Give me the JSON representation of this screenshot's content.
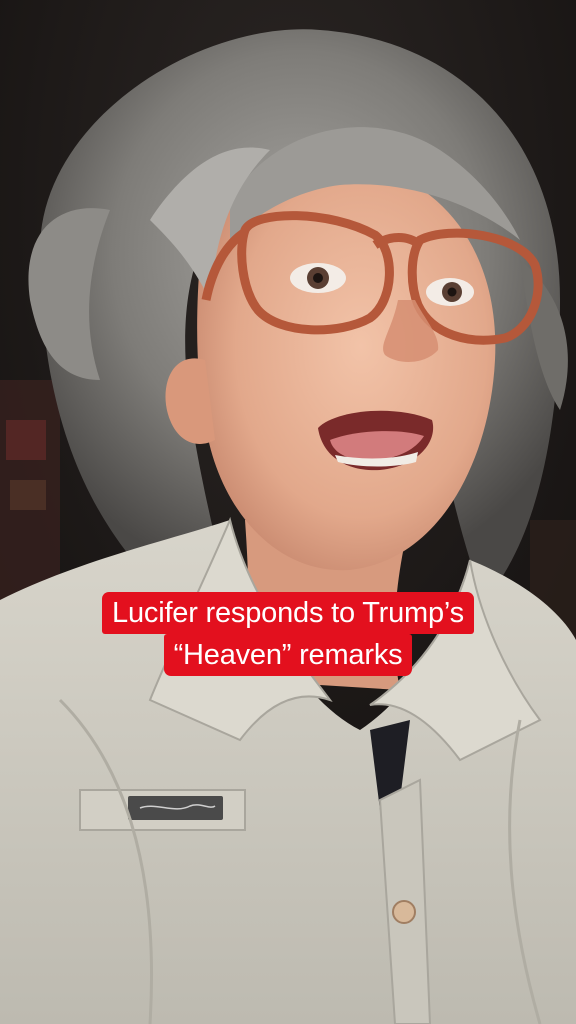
{
  "caption": {
    "line1": "Lucifer responds to Trump’s",
    "line2": "“Heaven” remarks",
    "background_color": "#e3101e",
    "text_color": "#ffffff"
  },
  "scene": {
    "subject": "person-with-gray-hair-and-glasses",
    "shirt_color": "#cfccc2",
    "hair_color": "#8e8c88",
    "background_color": "#1a1716"
  }
}
